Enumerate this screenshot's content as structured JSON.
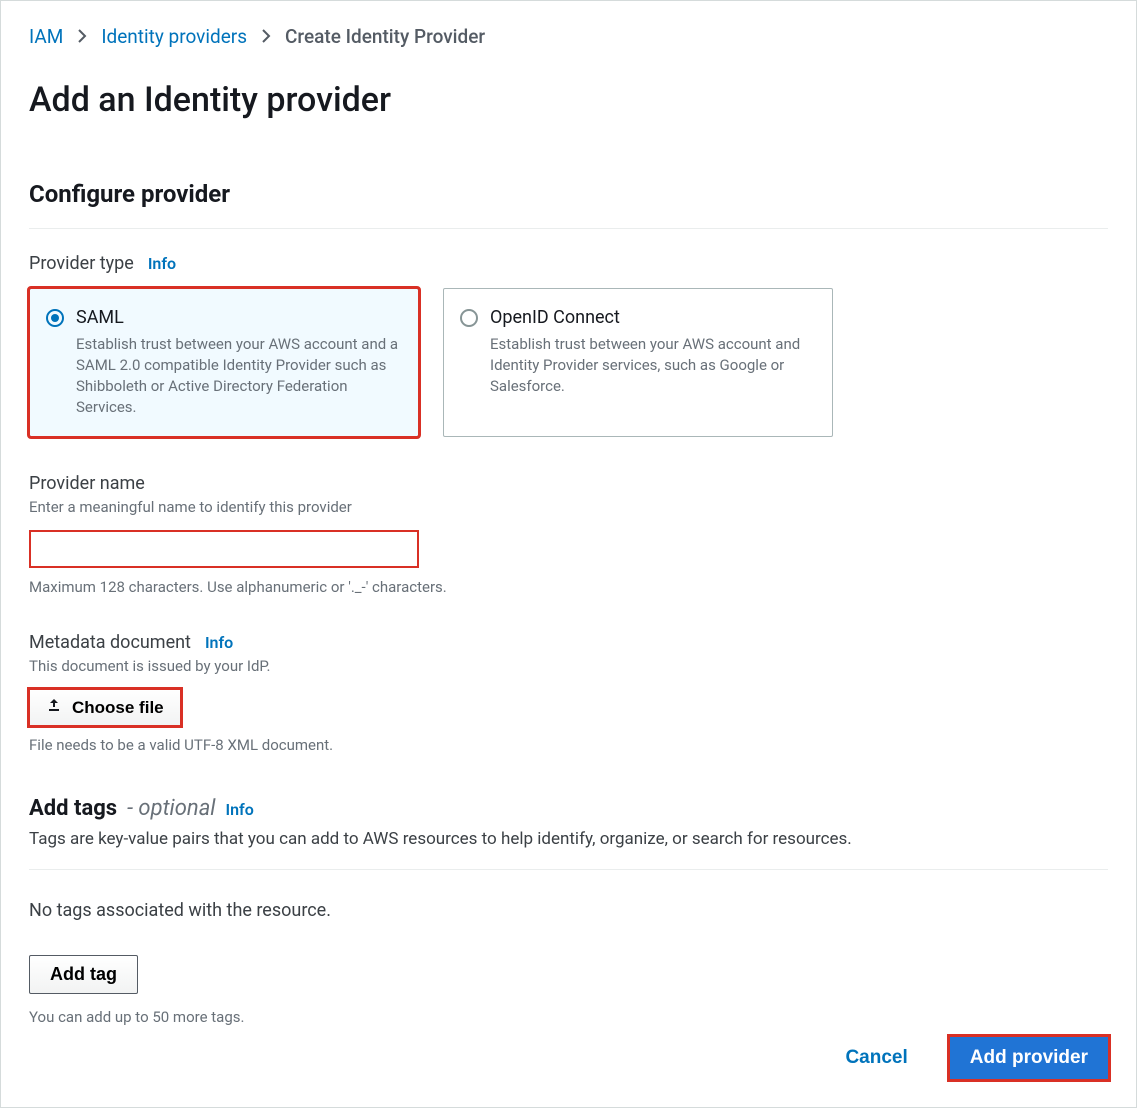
{
  "breadcrumb": {
    "root": "IAM",
    "mid": "Identity providers",
    "current": "Create Identity Provider"
  },
  "page_title": "Add an Identity provider",
  "configure": {
    "heading": "Configure provider",
    "provider_type_label": "Provider type",
    "info": "Info",
    "options": {
      "saml": {
        "title": "SAML",
        "desc": "Establish trust between your AWS account and a SAML 2.0 compatible Identity Provider such as Shibboleth or Active Directory Federation Services."
      },
      "oidc": {
        "title": "OpenID Connect",
        "desc": "Establish trust between your AWS account and Identity Provider services, such as Google or Salesforce."
      }
    },
    "provider_name": {
      "label": "Provider name",
      "hint": "Enter a meaningful name to identify this provider",
      "value": "",
      "help": "Maximum 128 characters. Use alphanumeric or '._-' characters."
    },
    "metadata": {
      "label": "Metadata document",
      "hint": "This document is issued by your IdP.",
      "button": "Choose file",
      "help": "File needs to be a valid UTF-8 XML document."
    }
  },
  "tags": {
    "title": "Add tags",
    "optional": "- optional",
    "info": "Info",
    "desc": "Tags are key-value pairs that you can add to AWS resources to help identify, organize, or search for resources.",
    "empty": "No tags associated with the resource.",
    "add_button": "Add tag",
    "limit_hint": "You can add up to 50 more tags."
  },
  "footer": {
    "cancel": "Cancel",
    "submit": "Add provider"
  }
}
